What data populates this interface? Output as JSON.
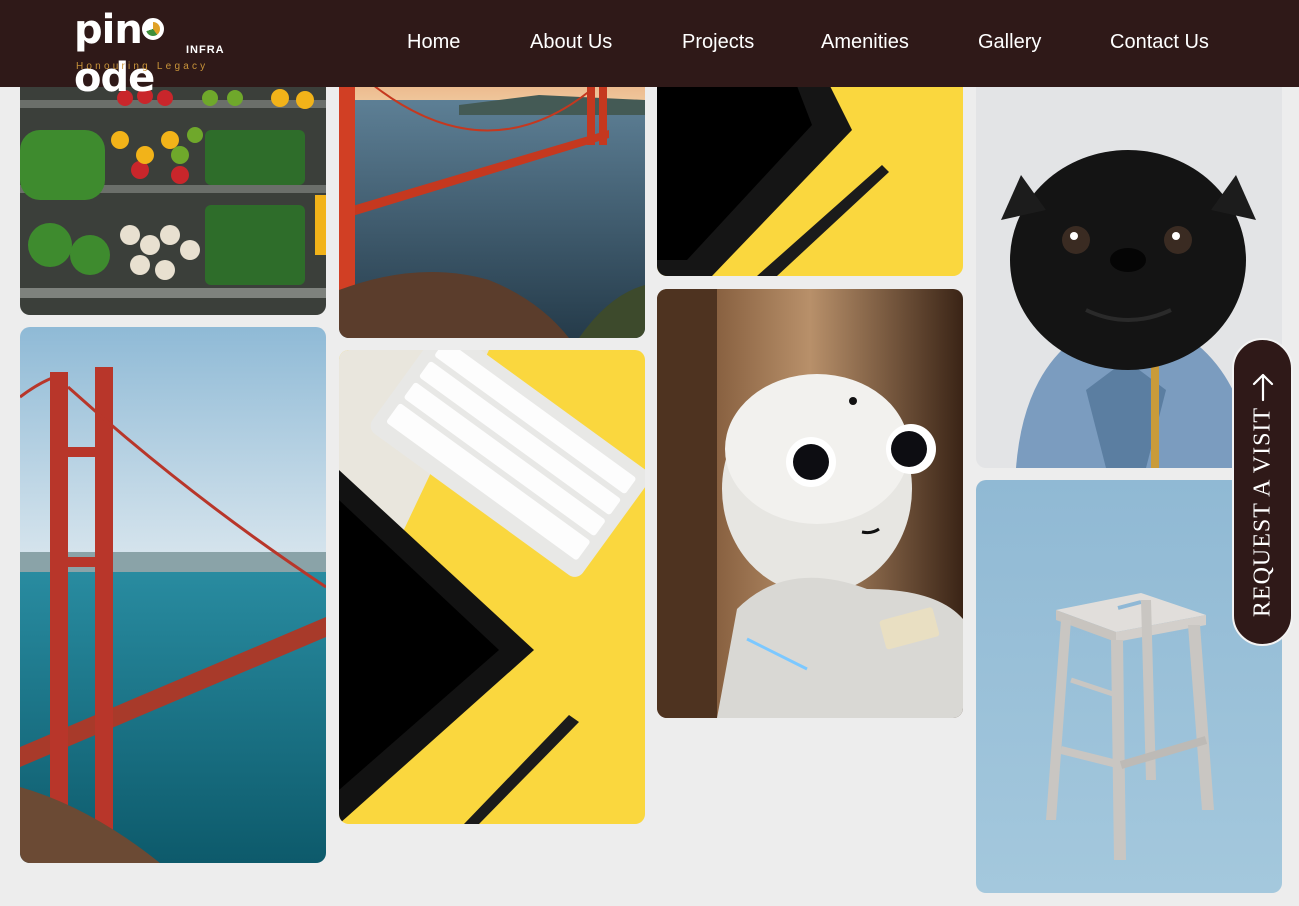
{
  "brand": {
    "name_part1": "pin",
    "name_part2": "ode",
    "sub": "INFRA",
    "tagline": "Honouring Legacy"
  },
  "nav": {
    "items": [
      {
        "label": "Home"
      },
      {
        "label": "About Us"
      },
      {
        "label": "Projects"
      },
      {
        "label": "Amenities"
      },
      {
        "label": "Gallery"
      },
      {
        "label": "Contact Us"
      }
    ]
  },
  "gallery": {
    "images": [
      {
        "subject": "vegetables-market"
      },
      {
        "subject": "golden-gate-bridge-sunset"
      },
      {
        "subject": "tablet-on-yellow"
      },
      {
        "subject": "pug-in-denim-jacket"
      },
      {
        "subject": "golden-gate-bridge-day"
      },
      {
        "subject": "keyboard-and-tablet-on-yellow"
      },
      {
        "subject": "robot"
      },
      {
        "subject": "wooden-stool"
      }
    ]
  },
  "cta": {
    "label": "REQUEST A VISIT",
    "icon": "arrow-up-icon"
  },
  "colors": {
    "header_bg": "#2f1918",
    "page_bg": "#ededed",
    "accent": "#c9943a"
  }
}
